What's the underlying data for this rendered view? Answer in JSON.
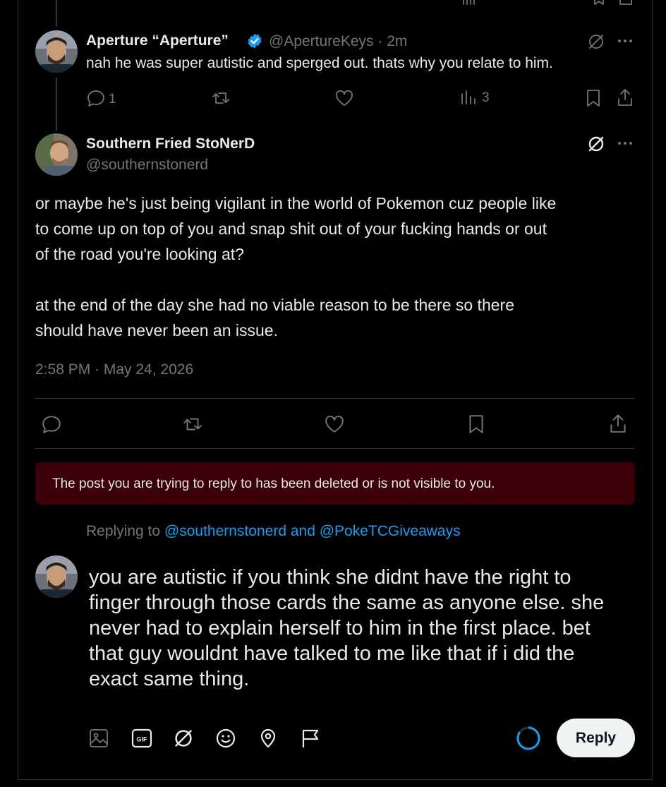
{
  "tweet1": {
    "display_name": "Aperture “Aperture”",
    "handle_time": "@ApertureKeys · 2m",
    "text": "nah he was super autistic and sperged out. thats why you relate to him.",
    "reply_count": "1",
    "view_count": "3"
  },
  "tweet2": {
    "display_name": "Southern Fried StoNerD",
    "handle": "@southernstonerd",
    "paragraph1_line1": "or maybe he's just being vigilant in the world of Pokemon cuz people like",
    "paragraph1_line2": "to come up on top of you and snap shit out of your fucking hands or out",
    "paragraph1_line3": "of the road you're looking at?",
    "paragraph2_line1": "at the end of the day she had no viable reason to be there so there",
    "paragraph2_line2": "should have never been an issue.",
    "timestamp": "2:58 PM · May 24, 2026"
  },
  "error_message": "The post you are trying to reply to has been deleted or is not visible to you.",
  "replying": {
    "prefix": "Replying to",
    "user1": "@southernstonerd",
    "conj": "and",
    "user2": "@PokeTCGiveaways"
  },
  "composer": {
    "line1": "you are autistic if you think she didnt have the right to",
    "line2": "finger through those cards the same as anyone else. she",
    "line3": "never had to explain herself to him in the first place. bet",
    "line4": "that guy wouldnt have talked to me like that if i did the",
    "line5": "exact same thing.",
    "reply_label": "Reply",
    "gif_label": "GIF"
  },
  "colors": {
    "accent": "#1d9bf0",
    "error_bg": "#3b0008",
    "muted": "#71767b"
  },
  "icons": {
    "verified": "verified-badge-icon",
    "grok": "grok-icon",
    "more": "more-icon",
    "reply": "reply-icon",
    "retweet": "retweet-icon",
    "like": "like-icon",
    "views": "views-icon",
    "bookmark": "bookmark-icon",
    "share": "share-icon",
    "media": "media-icon",
    "gif": "gif-icon",
    "emoji": "emoji-icon",
    "location": "location-icon",
    "flag": "flag-icon",
    "progress": "char-count-ring"
  }
}
